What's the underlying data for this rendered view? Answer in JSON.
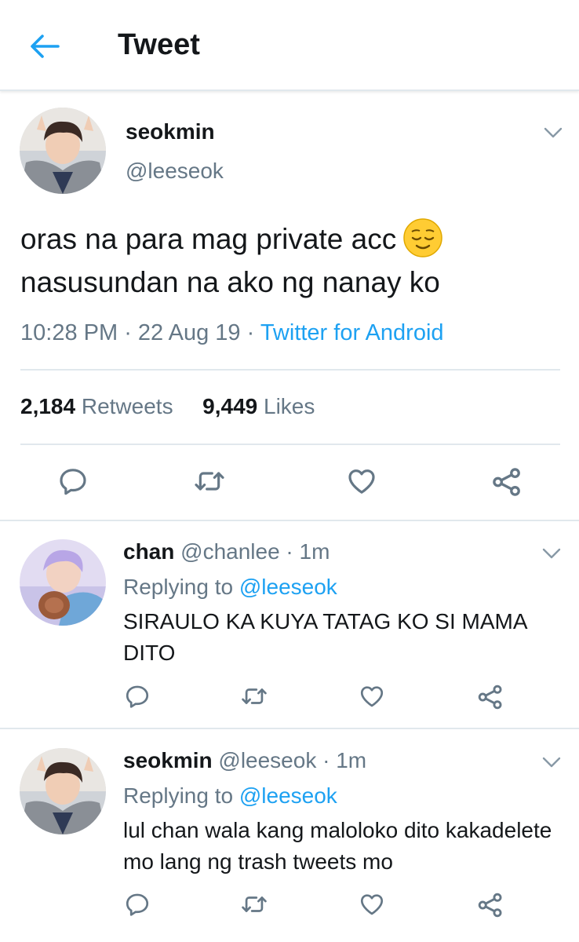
{
  "header": {
    "title": "Tweet"
  },
  "tweet": {
    "name": "seokmin",
    "handle": "@leeseok",
    "text_line1": "oras na para mag private acc",
    "text_line2": "nasusundan na ako ng nanay ko",
    "time": "10:28 PM",
    "date": "22 Aug 19",
    "sep": " · ",
    "source": "Twitter for Android",
    "retweets_count": "2,184",
    "retweets_label": "Retweets",
    "likes_count": "9,449",
    "likes_label": "Likes"
  },
  "replies": [
    {
      "name": "chan",
      "handle": "@chanlee",
      "time": "1m",
      "replying_prefix": "Replying to",
      "replying_to": "@leeseok",
      "text": "SIRAULO KA KUYA TATAG KO SI MAMA DITO"
    },
    {
      "name": "seokmin",
      "handle": "@leeseok",
      "time": "1m",
      "replying_prefix": "Replying to",
      "replying_to": "@leeseok",
      "text": "lul chan wala kang maloloko dito kakadelete mo lang ng trash tweets mo"
    }
  ],
  "icons": {
    "back": "arrow-left-icon",
    "caret": "chevron-down-icon",
    "reply": "reply-icon",
    "retweet": "retweet-icon",
    "like": "heart-icon",
    "share": "share-icon",
    "emoji": "relieved-face-emoji"
  },
  "colors": {
    "accent": "#1da1f2",
    "secondary_text": "#657786",
    "icon": "#657786",
    "divider": "#e1e8ed"
  }
}
